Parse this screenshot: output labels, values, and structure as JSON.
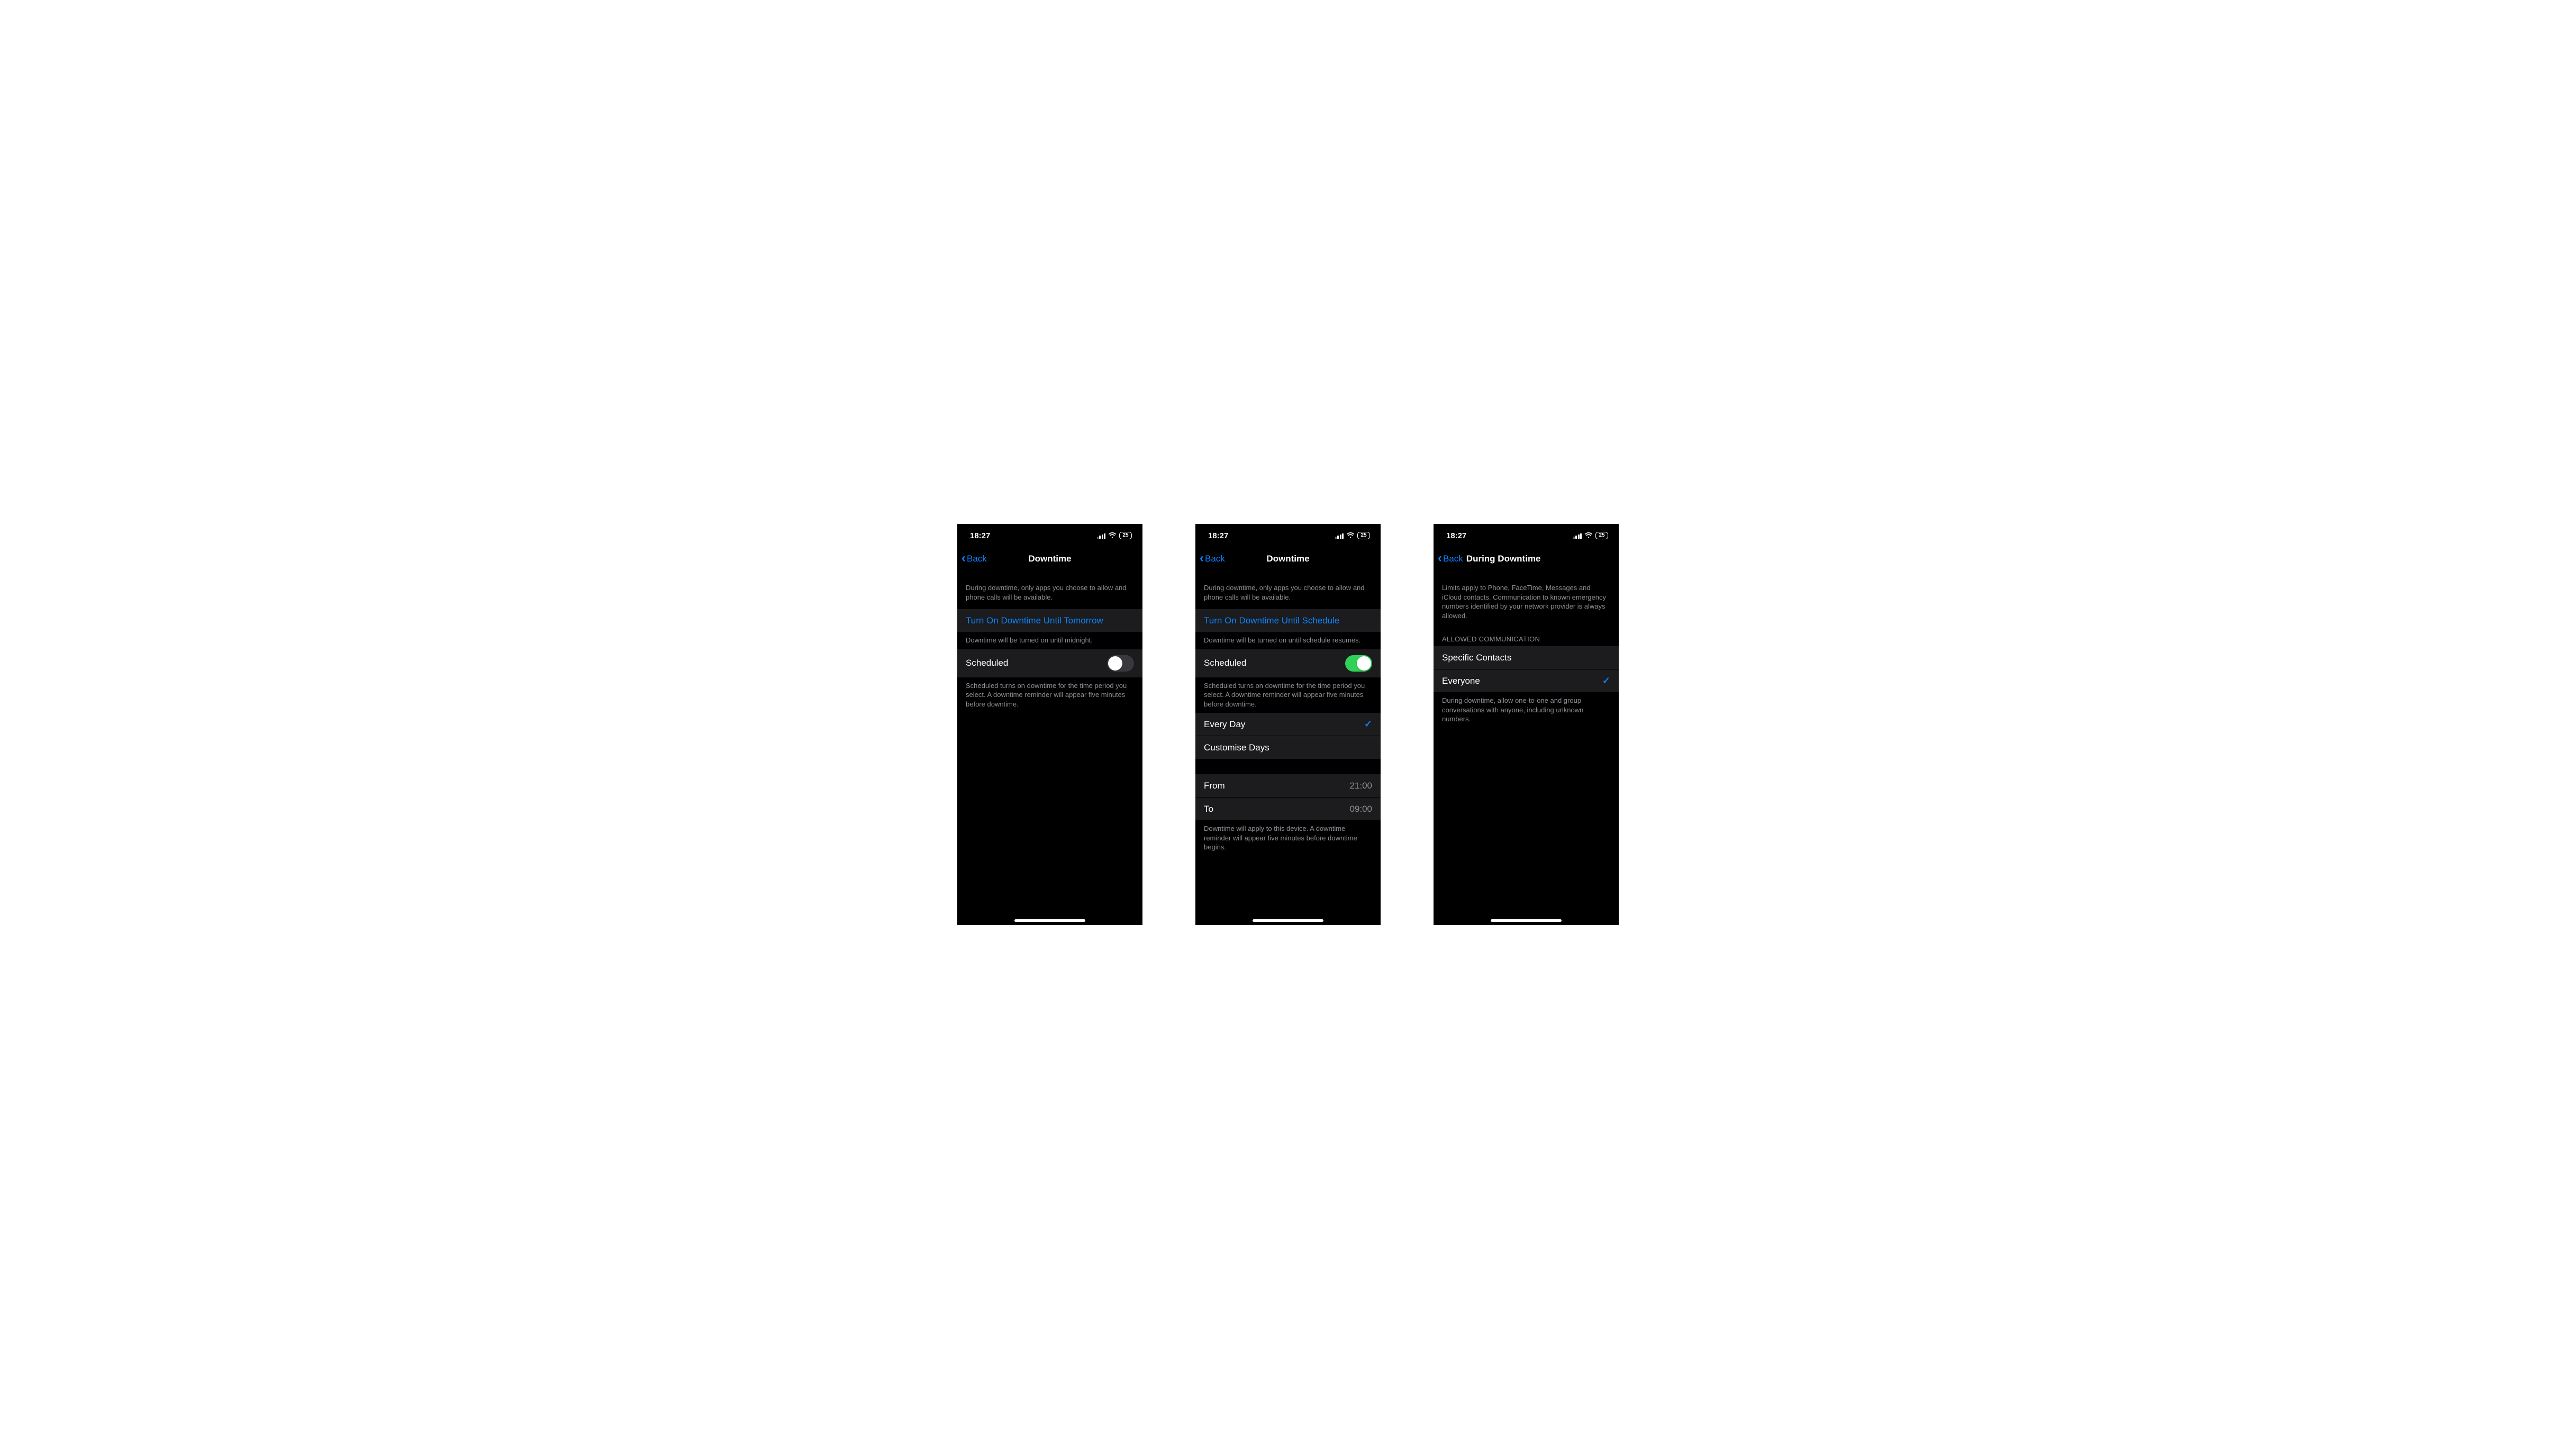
{
  "status": {
    "time": "18:27",
    "battery": "25"
  },
  "nav": {
    "back": "Back"
  },
  "screen1": {
    "title": "Downtime",
    "intro": "During downtime, only apps you choose to allow and phone calls will be available.",
    "turn_on": "Turn On Downtime Until Tomorrow",
    "turn_on_caption": "Downtime will be turned on until midnight.",
    "scheduled_label": "Scheduled",
    "scheduled_on": false,
    "scheduled_caption": "Scheduled turns on downtime for the time period you select. A downtime reminder will appear five minutes before downtime."
  },
  "screen2": {
    "title": "Downtime",
    "intro": "During downtime, only apps you choose to allow and phone calls will be available.",
    "turn_on": "Turn On Downtime Until Schedule",
    "turn_on_caption": "Downtime will be turned on until schedule resumes.",
    "scheduled_label": "Scheduled",
    "scheduled_on": true,
    "scheduled_caption": "Scheduled turns on downtime for the time period you select. A downtime reminder will appear five minutes before downtime.",
    "every_day": "Every Day",
    "customise_days": "Customise Days",
    "from_label": "From",
    "from_value": "21:00",
    "to_label": "To",
    "to_value": "09:00",
    "time_caption": "Downtime will apply to this device. A downtime reminder will appear five minutes before downtime begins."
  },
  "screen3": {
    "title": "During Downtime",
    "intro": "Limits apply to Phone, FaceTime, Messages and iCloud contacts. Communication to known emergency numbers identified by your network provider is always allowed.",
    "section_header": "ALLOWED COMMUNICATION",
    "specific_contacts": "Specific Contacts",
    "everyone": "Everyone",
    "everyone_selected": true,
    "everyone_caption": "During downtime, allow one-to-one and group conversations with anyone, including unknown numbers."
  }
}
